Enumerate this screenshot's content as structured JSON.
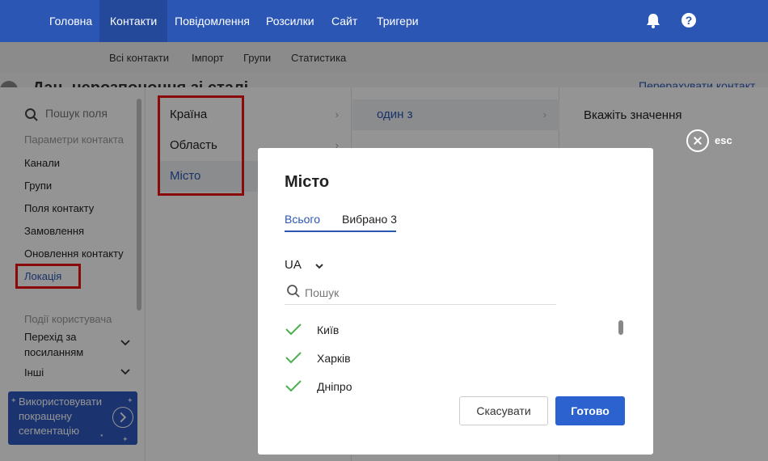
{
  "topnav": {
    "items": [
      "Головна",
      "Контакти",
      "Повідомлення",
      "Розсилки",
      "Сайт",
      "Тригери"
    ],
    "active": "Контакти",
    "icons": [
      "bell-icon",
      "help-icon"
    ]
  },
  "subnav": {
    "items": [
      "Всі контакти",
      "Імпорт",
      "Групи",
      "Статистика"
    ]
  },
  "behind": {
    "title": "Дан. нерозпононня зі сталі",
    "link": "Перерахувати контакт"
  },
  "filter": {
    "search_placeholder": "Пошук поля",
    "section_contact": "Параметри контакта",
    "contact_items": [
      "Канали",
      "Групи",
      "Поля контакту",
      "Замовлення",
      "Оновлення контакту",
      "Локація"
    ],
    "selected_item": "Локація",
    "section_events": "Події користувача",
    "event_items": [
      "Перехід за посиланням",
      "Інші"
    ],
    "promo_text": "Використовувати покращену сегментацію",
    "location_fields": [
      "Країна",
      "Область",
      "Місто"
    ],
    "selected_field": "Місто",
    "operator": "один з",
    "value_prompt": "Вкажіть значення",
    "esc_label": "esc"
  },
  "modal": {
    "title": "Місто",
    "tabs": [
      "Всього",
      "Вибрано 3"
    ],
    "active_tab": "Всього",
    "country": "UA",
    "search_placeholder": "Пошук",
    "cities": [
      "Київ",
      "Харків",
      "Дніпро"
    ],
    "cancel_label": "Скасувати",
    "done_label": "Готово"
  },
  "colors": {
    "nav_bg": "#2b56b4",
    "accent": "#2b56b4",
    "check": "#4caf50",
    "highlight_border": "#ee1111"
  }
}
